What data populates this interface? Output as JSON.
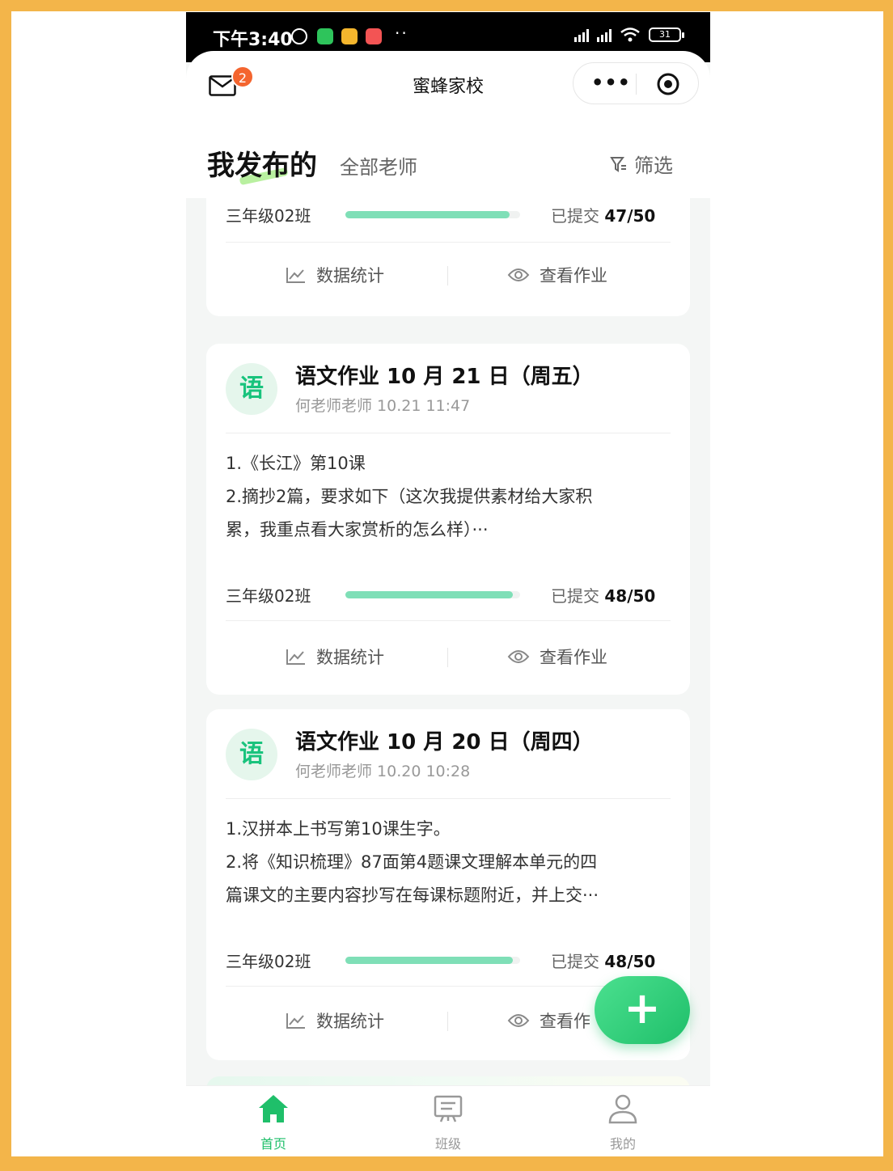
{
  "status_bar": {
    "time": "下午3:40",
    "overflow_dots": "··",
    "battery": "31"
  },
  "nav": {
    "title": "蜜蜂家校",
    "mail_badge": "2",
    "more_label": "•••"
  },
  "header": {
    "title": "我发布的",
    "subtitle": "全部老师",
    "filter_label": "筛选"
  },
  "cards": [
    {
      "class_name": "三年级02班",
      "submitted_label": "已提交",
      "submitted_count": "47/50",
      "progress": 0.94,
      "stats_label": "数据统计",
      "view_label": "查看作业"
    },
    {
      "subject": "语",
      "title": "语文作业 10 月 21 日（周五）",
      "meta": "何老师老师 10.21 11:47",
      "lines": [
        "1.《长江》第10课",
        "2.摘抄2篇，要求如下（这次我提供素材给大家积",
        "累，我重点看大家赏析的怎么样）···"
      ],
      "class_name": "三年级02班",
      "submitted_label": "已提交",
      "submitted_count": "48/50",
      "progress": 0.96,
      "stats_label": "数据统计",
      "view_label": "查看作业"
    },
    {
      "subject": "语",
      "title": "语文作业 10 月 20 日（周四）",
      "meta": "何老师老师 10.20 10:28",
      "lines": [
        "1.汉拼本上书写第10课生字。",
        "2.将《知识梳理》87面第4题课文理解本单元的四",
        "篇课文的主要内容抄写在每课标题附近，并上交···"
      ],
      "class_name": "三年级02班",
      "submitted_label": "已提交",
      "submitted_count": "48/50",
      "progress": 0.96,
      "stats_label": "数据统计",
      "view_label": "查看作"
    }
  ],
  "fab_label": "+",
  "tabbar": {
    "items": [
      {
        "label": "首页",
        "icon": "home-icon",
        "active": true
      },
      {
        "label": "班级",
        "icon": "class-board-icon",
        "active": false
      },
      {
        "label": "我的",
        "icon": "profile-icon",
        "active": false
      }
    ]
  },
  "colors": {
    "accent": "#1fbf6a",
    "progress": "#7fdfb7",
    "badge": "#f4652f"
  }
}
